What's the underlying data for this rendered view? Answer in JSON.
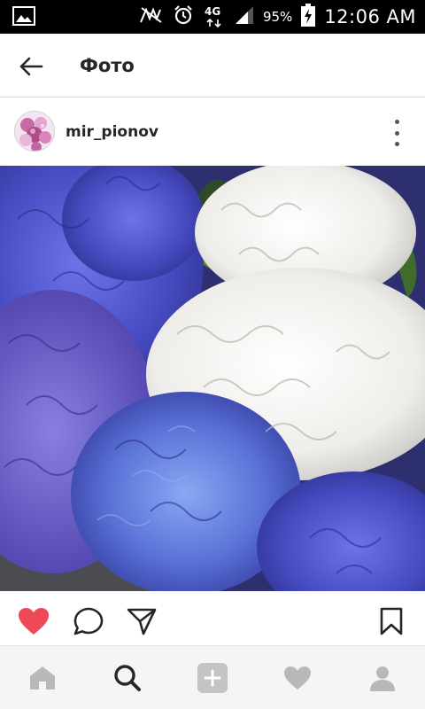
{
  "status_bar": {
    "network": "4G",
    "battery_percent": "95%",
    "time": "12:06 AM",
    "icons": [
      "image-notification-icon",
      "no-signal-icon",
      "alarm-icon",
      "data-arrows-icon",
      "signal-bars-icon",
      "battery-charging-icon"
    ]
  },
  "header": {
    "title": "Фото",
    "back_icon": "arrow-left-icon"
  },
  "post": {
    "username": "mir_pionov",
    "avatar": "avatar-flowers",
    "more_icon": "vertical-dots-icon",
    "photo": "hydrangeas-photo",
    "liked": true,
    "colors": {
      "like": "#ed4956",
      "hydrangea_blue": "#4a4fc8",
      "hydrangea_white": "#f2f1ee"
    }
  },
  "actions": {
    "like_icon": "heart-filled-icon",
    "comment_icon": "comment-icon",
    "share_icon": "share-icon",
    "save_icon": "bookmark-icon"
  },
  "bottom_nav": {
    "items": [
      {
        "icon": "home-icon",
        "active": false
      },
      {
        "icon": "search-icon",
        "active": true
      },
      {
        "icon": "add-post-icon",
        "active": false
      },
      {
        "icon": "activity-heart-icon",
        "active": false
      },
      {
        "icon": "profile-icon",
        "active": false
      }
    ]
  }
}
